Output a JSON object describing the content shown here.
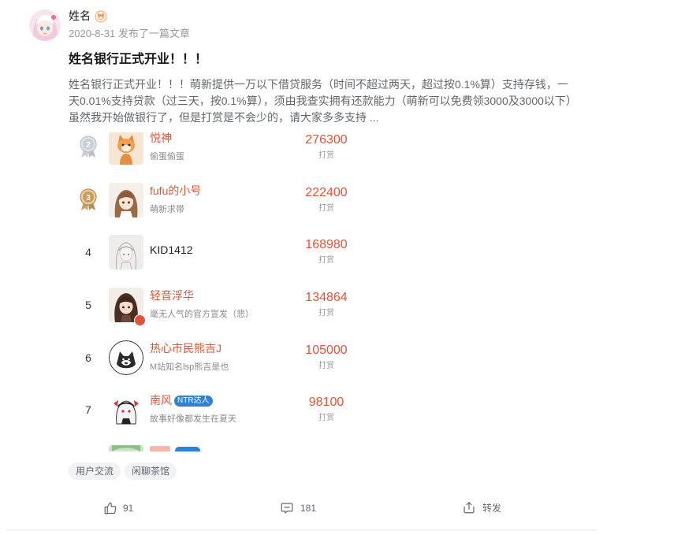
{
  "author": {
    "name": "姓名",
    "avatar": "anime-girl-avatar",
    "badge": "fox-badge-icon"
  },
  "post": {
    "meta": "2020-8-31 发布了一篇文章",
    "title": "姓名银行正式开业！！！",
    "body_lines": [
      "姓名银行正式开业！！！萌新提供一万以下借贷服务（时间不超过两天，超过按0.1%算）支持存钱，一",
      "天0.01%支持贷款（过三天，按0.1%算），须由我查实拥有还款能力（萌新可以免费领3000及3000以下）",
      "虽然我开始做银行了，但是打赏是不会少的，请大家多多支持 ..."
    ]
  },
  "leaderboard": {
    "rows": [
      {
        "rank": "2",
        "medal": "silver-medal-icon",
        "name": "悦神",
        "subtitle": "偷蛋偷蛋",
        "amount": "276300",
        "amount_label": "打赏"
      },
      {
        "rank": "3",
        "medal": "bronze-medal-icon",
        "name": "fufu的小号",
        "subtitle": "萌新求带",
        "amount": "222400",
        "amount_label": "打赏"
      },
      {
        "rank": "4",
        "name": "KID1412",
        "amount": "168980",
        "amount_label": "打赏"
      },
      {
        "rank": "5",
        "name": "轻音浮华",
        "subtitle": "毫无人气的官方宣发（悲）",
        "amount": "134864",
        "amount_label": "打赏",
        "avatar_badge": "verified-badge-icon"
      },
      {
        "rank": "6",
        "name": "热心市民熊吉J",
        "subtitle": "M站知名lsp熊吉是也",
        "amount": "105000",
        "amount_label": "打赏"
      },
      {
        "rank": "7",
        "name": "南风",
        "name_badge": "NTR达人",
        "subtitle": "故事好像都发生在夏天",
        "amount": "98100",
        "amount_label": "打赏"
      }
    ]
  },
  "tags": [
    "用户交流",
    "闲聊茶馆"
  ],
  "actions": {
    "like_icon": "thumbs-up-icon",
    "like_count": "91",
    "comment_icon": "comment-icon",
    "comment_count": "181",
    "share_icon": "share-icon",
    "share_label": "转发"
  },
  "colors": {
    "accent": "#e0553a",
    "name_badge": "#2f83d6",
    "tag_bg": "#f1f2f3",
    "muted_text": "#61666d"
  }
}
